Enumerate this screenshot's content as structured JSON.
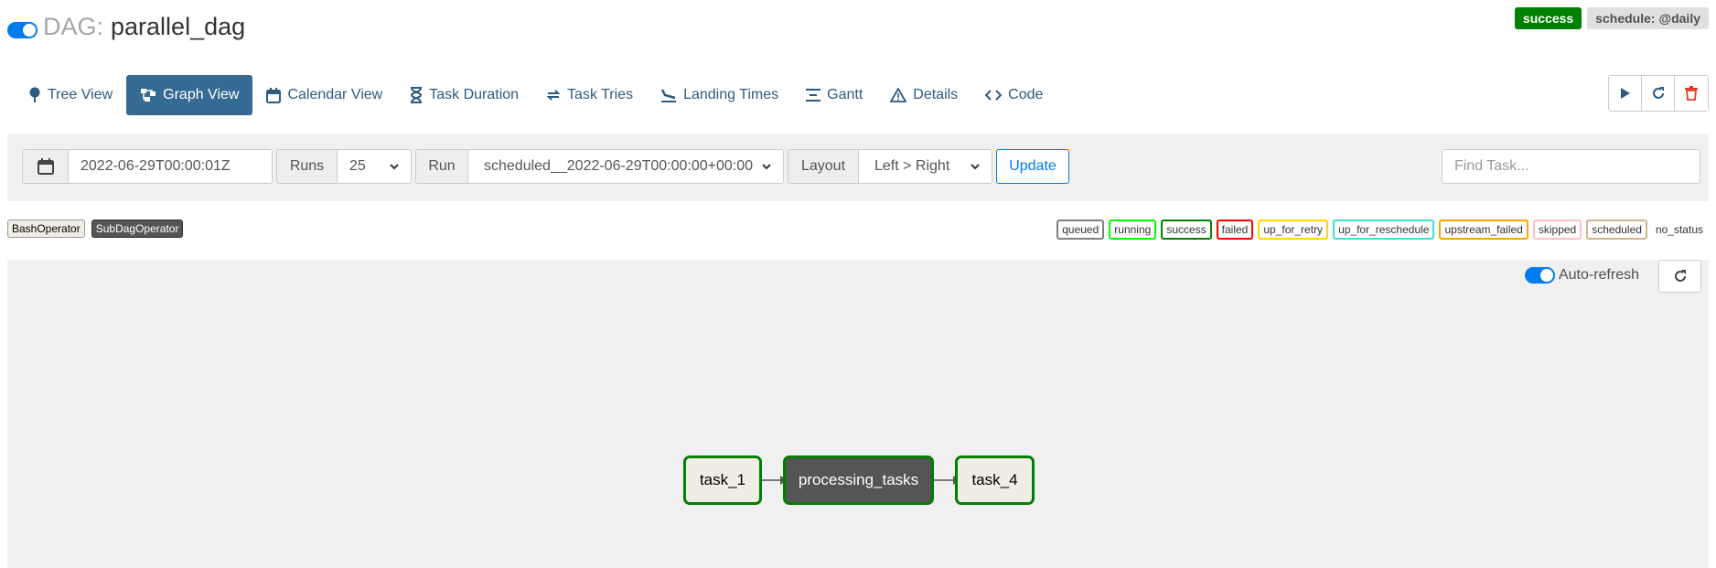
{
  "header": {
    "prefix": "DAG:",
    "dag_id": "parallel_dag"
  },
  "status": {
    "state": "success",
    "schedule": "schedule: @daily"
  },
  "nav": {
    "tabs": [
      {
        "label": "Tree View",
        "icon": "tree-icon"
      },
      {
        "label": "Graph View",
        "icon": "graph-icon",
        "active": true
      },
      {
        "label": "Calendar View",
        "icon": "calendar-icon"
      },
      {
        "label": "Task Duration",
        "icon": "hourglass-icon"
      },
      {
        "label": "Task Tries",
        "icon": "retry-icon"
      },
      {
        "label": "Landing Times",
        "icon": "landing-icon"
      },
      {
        "label": "Gantt",
        "icon": "gantt-icon"
      },
      {
        "label": "Details",
        "icon": "warning-triangle-icon"
      },
      {
        "label": "Code",
        "icon": "code-icon"
      }
    ],
    "actions": [
      {
        "icon": "play-icon"
      },
      {
        "icon": "refresh-icon"
      },
      {
        "icon": "trash-icon"
      }
    ]
  },
  "toolbar": {
    "date_value": "2022-06-29T00:00:01Z",
    "runs_label": "Runs",
    "runs_value": "25",
    "run_label": "Run",
    "run_value": "scheduled__2022-06-29T00:00:00+00:00",
    "layout_label": "Layout",
    "layout_value": "Left > Right",
    "update_label": "Update",
    "find_placeholder": "Find Task..."
  },
  "operators": [
    {
      "label": "BashOperator",
      "kind": "bash"
    },
    {
      "label": "SubDagOperator",
      "kind": "subdag"
    }
  ],
  "states": [
    {
      "label": "queued",
      "color": "#808080"
    },
    {
      "label": "running",
      "color": "#00ff00"
    },
    {
      "label": "success",
      "color": "#008000"
    },
    {
      "label": "failed",
      "color": "#ff0000"
    },
    {
      "label": "up_for_retry",
      "color": "#ffd700"
    },
    {
      "label": "up_for_reschedule",
      "color": "#40e0d0"
    },
    {
      "label": "upstream_failed",
      "color": "#ffa500"
    },
    {
      "label": "skipped",
      "color": "#ffc0cb"
    },
    {
      "label": "scheduled",
      "color": "#d2b48c"
    },
    {
      "label": "no_status",
      "color": ""
    }
  ],
  "graph": {
    "auto_refresh_label": "Auto-refresh",
    "nodes": [
      {
        "id": "task_1",
        "label": "task_1",
        "kind": "bash",
        "state": "success"
      },
      {
        "id": "processing_tasks",
        "label": "processing_tasks",
        "kind": "subdag",
        "state": "success"
      },
      {
        "id": "task_4",
        "label": "task_4",
        "kind": "bash",
        "state": "success"
      }
    ],
    "edges": [
      {
        "from": "task_1",
        "to": "processing_tasks"
      },
      {
        "from": "processing_tasks",
        "to": "task_4"
      }
    ]
  }
}
